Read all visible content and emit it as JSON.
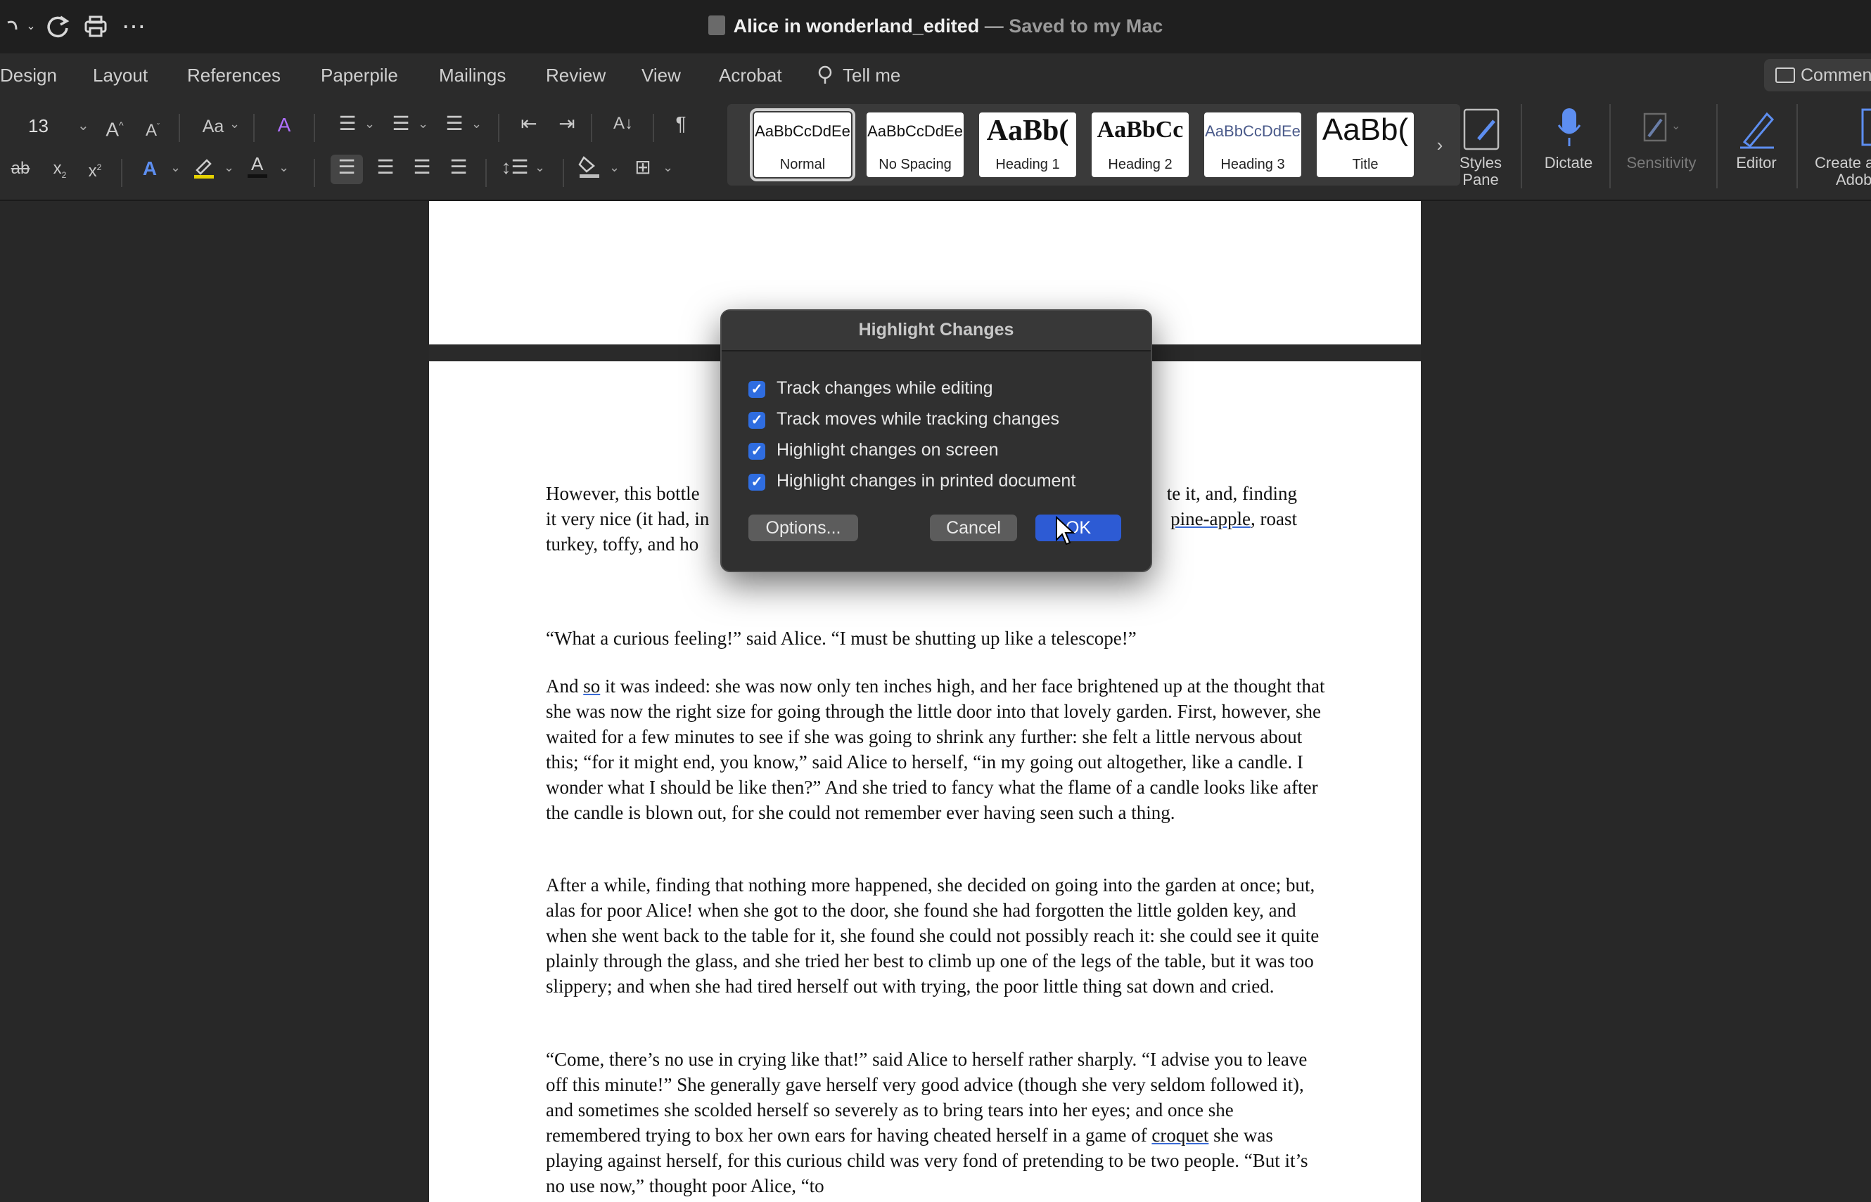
{
  "window": {
    "title_doc": "Alice in wonderland_edited",
    "title_status": " — Saved to my Mac"
  },
  "ribbon_tabs": [
    "Design",
    "Layout",
    "References",
    "Paperpile",
    "Mailings",
    "Review",
    "View",
    "Acrobat",
    "Tell me"
  ],
  "comments_label": "Commen",
  "font": {
    "size": "13"
  },
  "styles": [
    {
      "sample": "AaBbCcDdEe",
      "name": "Normal"
    },
    {
      "sample": "AaBbCcDdEe",
      "name": "No Spacing"
    },
    {
      "sample": "AaBb(",
      "name": "Heading 1"
    },
    {
      "sample": "AaBbCc",
      "name": "Heading 2"
    },
    {
      "sample": "AaBbCcDdEe",
      "name": "Heading 3"
    },
    {
      "sample": "AaBb(",
      "name": "Title"
    }
  ],
  "right_buttons": {
    "styles_pane": [
      "Styles",
      "Pane"
    ],
    "dictate": "Dictate",
    "sensitivity": "Sensitivity",
    "editor": "Editor",
    "create_adobe": [
      "Create a",
      "Adob"
    ]
  },
  "dialog": {
    "title": "Highlight Changes",
    "options": [
      {
        "label": "Track changes while editing",
        "checked": true
      },
      {
        "label": "Track moves while tracking changes",
        "checked": true
      },
      {
        "label": "Highlight changes on screen",
        "checked": true
      },
      {
        "label": "Highlight changes in printed document",
        "checked": true
      }
    ],
    "options_button": "Options...",
    "cancel_button": "Cancel",
    "ok_button": "OK"
  },
  "document": {
    "p1_l1_a": "However, this bottle",
    "p1_l1_b": "te it, and, finding",
    "p1_l2_a": "it very nice (it had, in",
    "p1_l2_b_u": "pine-apple",
    "p1_l2_c": ", roast",
    "p1_l3": "turkey, toffy, and ho",
    "p2": "“What a curious feeling!” said Alice. “I must be shutting up like a telescope!”",
    "p3_a": "And ",
    "p3_u": "so",
    "p3_b": " it was indeed: she was now only ten inches high, and her face brightened up at the thought that she was now the right size for going through the little door into that lovely garden. First, however, she waited for a few minutes to see if she was going to shrink any further: she felt a little nervous about this; “for it might end, you know,” said Alice to herself, “in my going out altogether, like a candle. I wonder what I should be like then?” And she tried to fancy what the flame of a candle looks like after the candle is blown out, for she could not remember ever having seen such a thing.",
    "p4": "After a while, finding that nothing more happened, she decided on going into the garden at once; but, alas for poor Alice! when she got to the door, she found she had forgotten the little golden key, and when she went back to the table for it, she found she could not possibly reach it: she could see it quite plainly through the glass, and she tried her best to climb up one of the legs of the table, but it was too slippery; and when she had tired herself out with trying, the poor little thing sat down and cried.",
    "p5_a": "“Come, there’s no use in crying like that!” said Alice to herself rather sharply. “I advise you to leave off this minute!” She generally gave herself very good advice (though she very seldom followed it), and sometimes she scolded herself so severely as to bring tears into her eyes; and once she remembered trying to box her own ears for having cheated herself in a game of ",
    "p5_u": "croquet",
    "p5_b": " she was playing against herself, for this curious child was very fond of pretending to be two people. “But it’s no use now,” thought poor Alice, “to"
  }
}
